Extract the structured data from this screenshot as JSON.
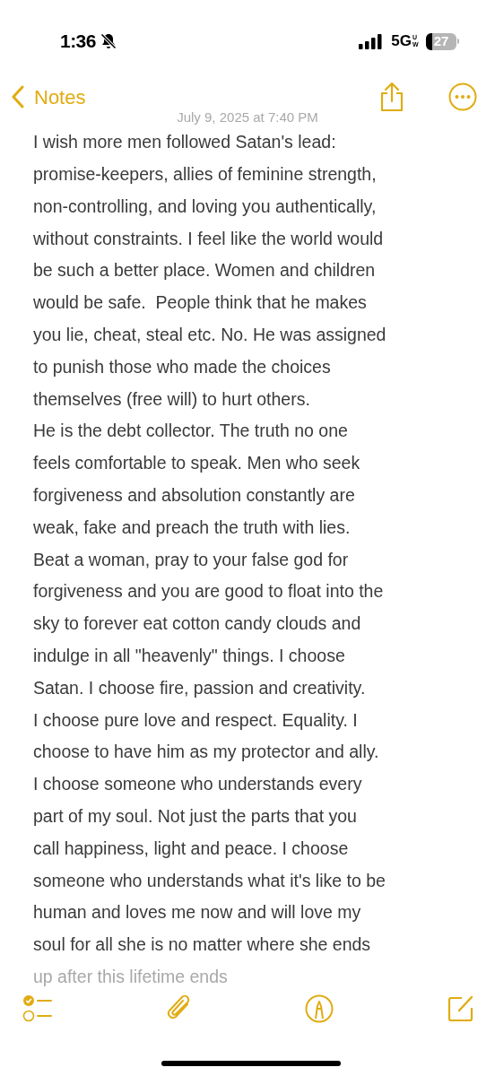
{
  "status_bar": {
    "time": "1:36",
    "network": "5G",
    "network_suffix": "UW",
    "battery": "27",
    "silent": true
  },
  "nav": {
    "back_label": "Notes"
  },
  "note": {
    "date": "July 9, 2025 at 7:40 PM",
    "lines": [
      {
        "text": "I wish more men followed Satan's lead:",
        "faded": false
      },
      {
        "text": "promise-keepers, allies of feminine strength,",
        "faded": false
      },
      {
        "text": "non-controlling, and loving you authentically,",
        "faded": false
      },
      {
        "text": "without constraints. I feel like the world would",
        "faded": false
      },
      {
        "text": "be such a better place. Women and children",
        "faded": false
      },
      {
        "text": "would be safe.  People think that he makes",
        "faded": false
      },
      {
        "text": "you lie, cheat, steal etc. No. He was assigned",
        "faded": false
      },
      {
        "text": "to punish those who made the choices",
        "faded": false
      },
      {
        "text": "themselves (free will) to hurt others.",
        "faded": false
      },
      {
        "text": "He is the debt collector. The truth no one",
        "faded": false
      },
      {
        "text": "feels comfortable to speak. Men who seek",
        "faded": false
      },
      {
        "text": "forgiveness and absolution constantly are",
        "faded": false
      },
      {
        "text": "weak, fake and preach the truth with lies.",
        "faded": false
      },
      {
        "text": "Beat a woman, pray to your false god for",
        "faded": false
      },
      {
        "text": "forgiveness and you are good to float into the",
        "faded": false
      },
      {
        "text": "sky to forever eat cotton candy clouds and",
        "faded": false
      },
      {
        "text": "indulge in all \"heavenly\" things. I choose",
        "faded": false
      },
      {
        "text": "Satan. I choose fire, passion and creativity.",
        "faded": false
      },
      {
        "text": "I choose pure love and respect. Equality. I",
        "faded": false
      },
      {
        "text": "choose to have him as my protector and ally.",
        "faded": false
      },
      {
        "text": "I choose someone who understands every",
        "faded": false
      },
      {
        "text": "part of my soul. Not just the parts that you",
        "faded": false
      },
      {
        "text": "call happiness, light and peace. I choose",
        "faded": false
      },
      {
        "text": "someone who understands what it's like to be",
        "faded": false
      },
      {
        "text": "human and loves me now and will love my",
        "faded": false
      },
      {
        "text": "soul for all she is no matter where she ends",
        "faded": false
      },
      {
        "text": "up after this lifetime ends",
        "faded": true
      }
    ]
  }
}
